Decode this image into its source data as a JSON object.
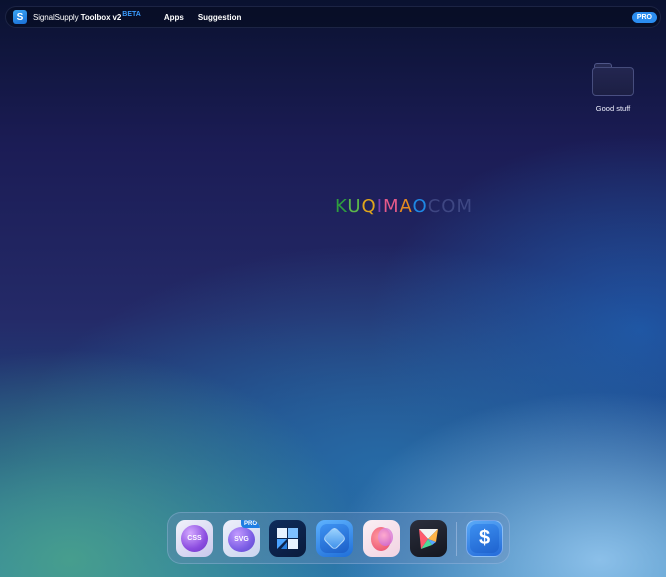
{
  "topbar": {
    "brand_prefix": "SignalSupply",
    "brand_suffix": "Toolbox v2",
    "beta_label": "BETA",
    "nav": [
      "Apps",
      "Suggestion"
    ],
    "pro_badge": "PRO",
    "logo_icon": "signalsupply-s-icon"
  },
  "desktop": {
    "folder": {
      "label": "Good stuff",
      "icon": "folder-icon"
    }
  },
  "watermark": {
    "letters": [
      "K",
      "U",
      "Q",
      "I",
      "M",
      "A",
      "O",
      "COM"
    ]
  },
  "dock": {
    "apps": [
      {
        "name": "css-app",
        "label": "CSS"
      },
      {
        "name": "svg-app",
        "label": "SVG",
        "badge": "PRO"
      },
      {
        "name": "blocks-app",
        "label": ""
      },
      {
        "name": "diamond-app",
        "label": ""
      },
      {
        "name": "blob-app",
        "label": ""
      },
      {
        "name": "prism-app",
        "label": ""
      },
      {
        "name": "dollar-app",
        "label": "$"
      }
    ]
  },
  "colors": {
    "accent": "#2b8df0",
    "beta": "#3b9cff",
    "topbar_bg": "#0a1230"
  }
}
